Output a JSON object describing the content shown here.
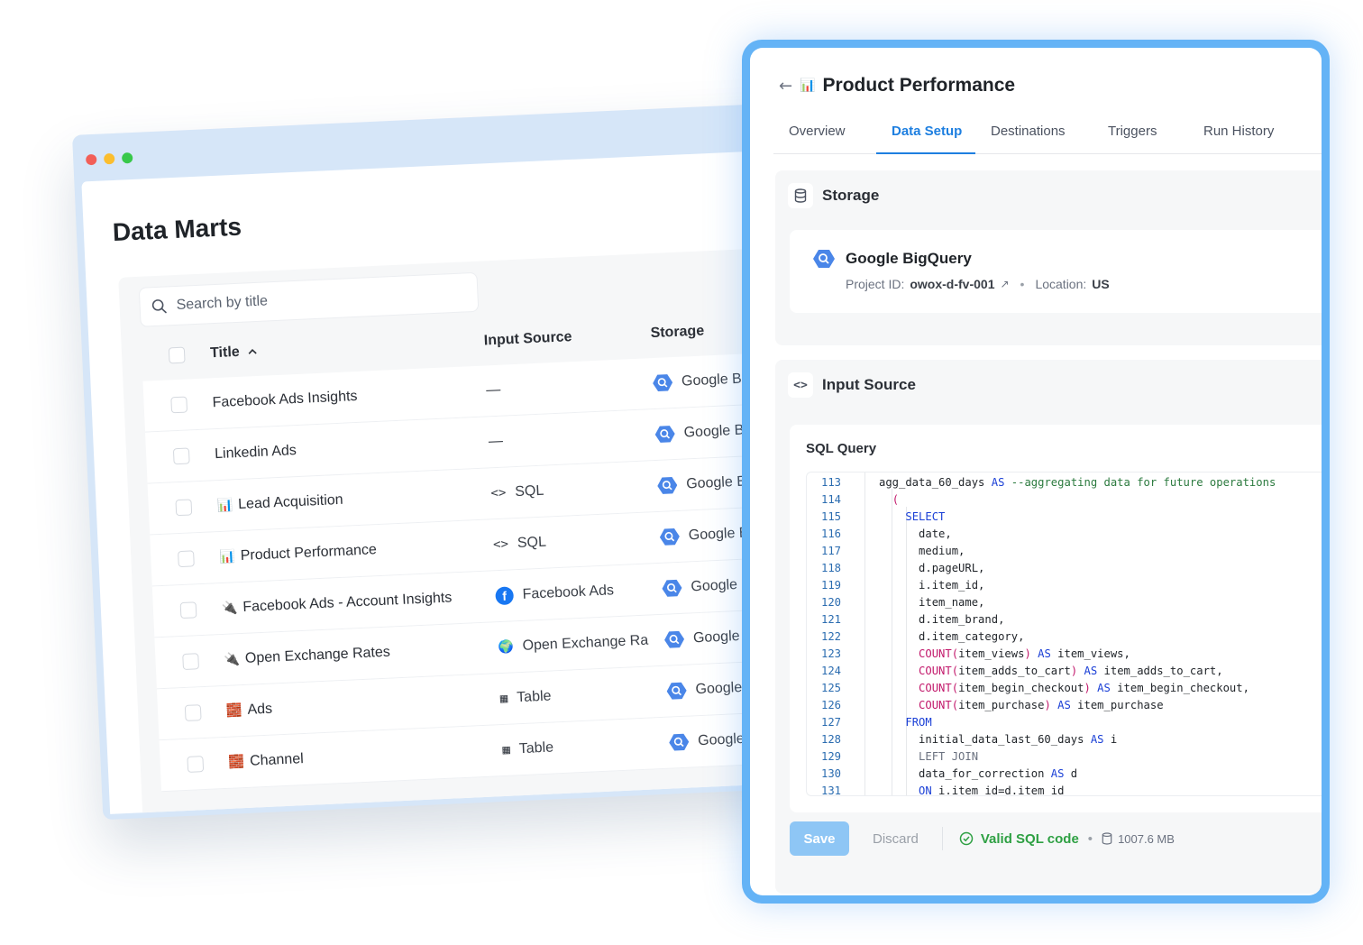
{
  "data_marts": {
    "title": "Data Marts",
    "search": {
      "placeholder": "Search by title"
    },
    "columns": {
      "title": "Title",
      "input_source": "Input Source",
      "storage": "Storage"
    },
    "rows": [
      {
        "icon": "",
        "title": "Facebook Ads Insights",
        "input_icon": "",
        "input": "—",
        "storage": "Google Big"
      },
      {
        "icon": "",
        "title": "Linkedin Ads",
        "input_icon": "",
        "input": "—",
        "storage": "Google Big"
      },
      {
        "icon": "📊",
        "title": "Lead Acquisition",
        "input_icon": "<>",
        "input": "SQL",
        "storage": "Google Big"
      },
      {
        "icon": "📊",
        "title": "Product Performance",
        "input_icon": "<>",
        "input": "SQL",
        "storage": "Google Big"
      },
      {
        "icon": "🔌",
        "title": "Facebook Ads - Account Insights",
        "input_icon": "f",
        "input": "Facebook Ads",
        "storage": "Google Bi"
      },
      {
        "icon": "🔌",
        "title": "Open Exchange Rates",
        "input_icon": "🌍",
        "input": "Open Exchange Ra",
        "storage": "Google Bi"
      },
      {
        "icon": "🧱",
        "title": "Ads",
        "input_icon": "▦",
        "input": "Table",
        "storage": "Google B"
      },
      {
        "icon": "🧱",
        "title": "Channel",
        "input_icon": "▦",
        "input": "Table",
        "storage": "Google B"
      }
    ]
  },
  "product": {
    "back_icon": "←",
    "title_icon": "📊",
    "title": "Product Performance",
    "tabs": [
      "Overview",
      "Data Setup",
      "Destinations",
      "Triggers",
      "Run History"
    ],
    "active_tab": "Data Setup",
    "storage": {
      "section_title": "Storage",
      "name": "Google BigQuery",
      "project_label": "Project ID:",
      "project_id": "owox-d-fv-001",
      "location_label": "Location:",
      "location": "US"
    },
    "input_source": {
      "section_title": "Input Source",
      "sql_label": "SQL Query",
      "lines": [
        {
          "n": "113",
          "text": "agg_data_60_days AS --aggregating data for future operations"
        },
        {
          "n": "114",
          "text": "  ("
        },
        {
          "n": "115",
          "text": "    SELECT"
        },
        {
          "n": "116",
          "text": "      date,"
        },
        {
          "n": "117",
          "text": "      medium,"
        },
        {
          "n": "118",
          "text": "      d.pageURL,"
        },
        {
          "n": "119",
          "text": "      i.item_id,"
        },
        {
          "n": "120",
          "text": "      item_name,"
        },
        {
          "n": "121",
          "text": "      d.item_brand,"
        },
        {
          "n": "122",
          "text": "      d.item_category,"
        },
        {
          "n": "123",
          "text": "      COUNT(item_views) AS item_views,"
        },
        {
          "n": "124",
          "text": "      COUNT(item_adds_to_cart) AS item_adds_to_cart,"
        },
        {
          "n": "125",
          "text": "      COUNT(item_begin_checkout) AS item_begin_checkout,"
        },
        {
          "n": "126",
          "text": "      COUNT(item_purchase) AS item_purchase"
        },
        {
          "n": "127",
          "text": "    FROM"
        },
        {
          "n": "128",
          "text": "      initial_data_last_60_days AS i"
        },
        {
          "n": "129",
          "text": "      LEFT JOIN"
        },
        {
          "n": "130",
          "text": "      data_for_correction AS d"
        },
        {
          "n": "131",
          "text": "      ON i.item_id=d.item_id"
        }
      ]
    },
    "footer": {
      "save": "Save",
      "discard": "Discard",
      "valid": "Valid SQL code",
      "size": "1007.6 MB"
    }
  },
  "colors": {
    "accent": "#1e7fe0",
    "frame": "#64b3f6",
    "valid": "#2ea043",
    "keyword": "#1a3fd6",
    "function": "#c2186b",
    "comment": "#2b7a3e"
  }
}
